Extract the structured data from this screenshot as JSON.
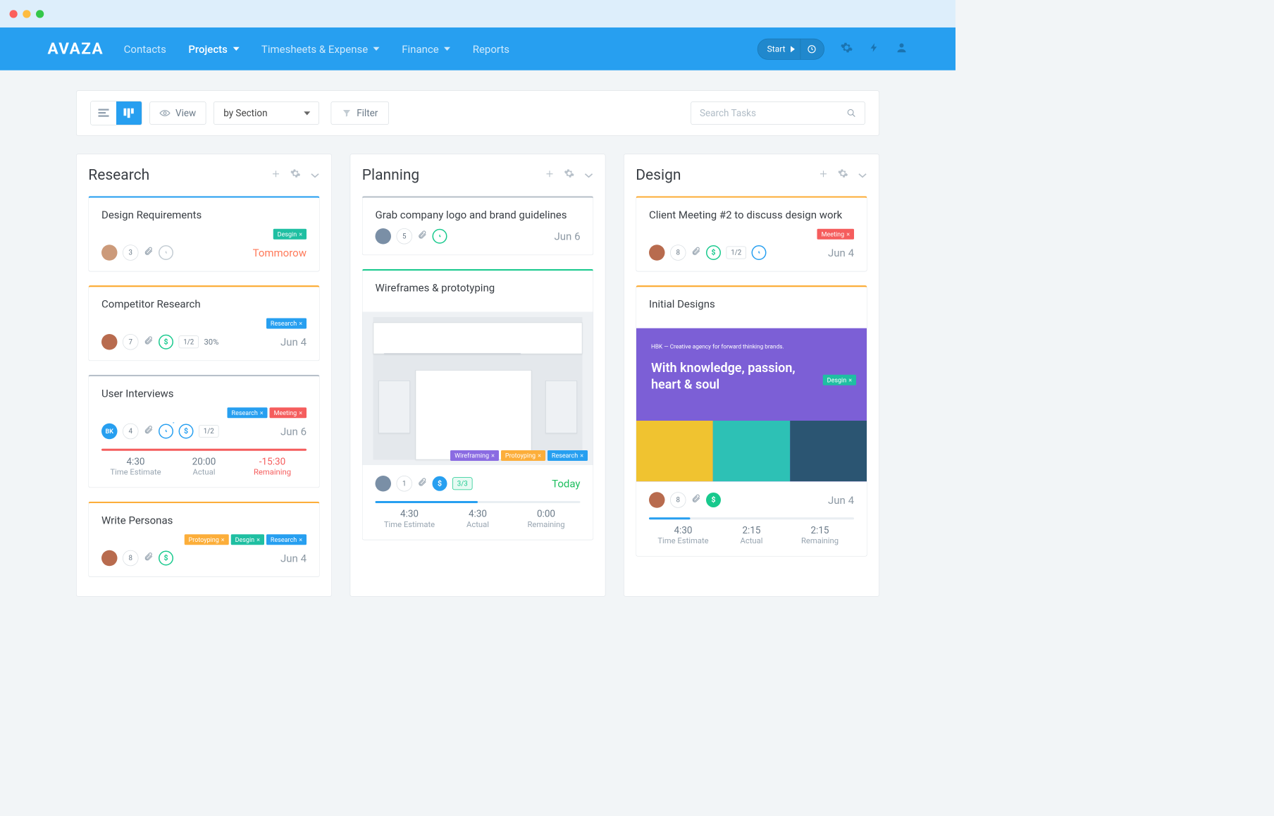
{
  "nav": {
    "logo": "AVAZA",
    "items": [
      "Contacts",
      "Projects",
      "Timesheets & Expense",
      "Finance",
      "Reports"
    ],
    "start": "Start"
  },
  "toolbar": {
    "view": "View",
    "view_value": "by Section",
    "filter": "Filter",
    "search_placeholder": "Search Tasks"
  },
  "columns": [
    {
      "title": "Research",
      "cards": [
        {
          "accent": "blue",
          "title": "Design Requirements",
          "tags": [
            {
              "label": "Desgin",
              "color": "t-teal"
            }
          ],
          "avatar": "a1",
          "comments": "3",
          "extra": [
            "clip",
            "clock-o"
          ],
          "due": "Tommorow",
          "due_class": "tomorrow"
        },
        {
          "accent": "orange",
          "title": "Competitor Research",
          "tags": [
            {
              "label": "Research",
              "color": "t-blue"
            }
          ],
          "avatar": "a2",
          "comments": "7",
          "extra": [
            "clip",
            "dollar-g",
            "ratio-12",
            "pct-30"
          ],
          "due": "Jun 4"
        },
        {
          "accent": "gray",
          "title": "User Interviews",
          "tags": [
            {
              "label": "Research",
              "color": "t-blue"
            },
            {
              "label": "Meeting",
              "color": "t-red"
            }
          ],
          "avatar": "bk",
          "avatar_text": "BK",
          "comments": "4",
          "extra": [
            "clip",
            "clock-b-tick",
            "dollar-b",
            "ratio-12"
          ],
          "due": "Jun 6",
          "progress": {
            "color": "red",
            "pct": 100
          },
          "times": {
            "estimate": "4:30",
            "actual": "20:00",
            "remaining": "-15:30",
            "neg": true
          }
        },
        {
          "accent": "orange",
          "title": "Write Personas",
          "tags": [
            {
              "label": "Protoyping",
              "color": "t-orange"
            },
            {
              "label": "Desgin",
              "color": "t-teal"
            },
            {
              "label": "Research",
              "color": "t-blue"
            }
          ],
          "avatar": "a2",
          "comments": "8",
          "extra": [
            "clip",
            "dollar-g"
          ],
          "due": "Jun 4"
        }
      ]
    },
    {
      "title": "Planning",
      "cards": [
        {
          "accent": "gray",
          "title": "Grab company logo and brand guidelines",
          "avatar": "a3",
          "comments": "5",
          "extra": [
            "clip",
            "clock-g"
          ],
          "due": "Jun 6"
        },
        {
          "accent": "green",
          "title": "Wireframes & prototyping",
          "thumb": "wire",
          "thumb_tags": [
            {
              "label": "Wireframing",
              "color": "t-purple"
            },
            {
              "label": "Protoyping",
              "color": "t-orange"
            },
            {
              "label": "Research",
              "color": "t-blue"
            }
          ],
          "avatar": "a3",
          "comments": "1",
          "extra": [
            "clip",
            "dollar-fb",
            "ratio-33g"
          ],
          "due": "Today",
          "due_class": "today",
          "progress": {
            "color": "blue",
            "pct": 50
          },
          "times": {
            "estimate": "4:30",
            "actual": "4:30",
            "remaining": "0:00"
          }
        }
      ]
    },
    {
      "title": "Design",
      "cards": [
        {
          "accent": "orange",
          "title": "Client Meeting #2 to discuss design work",
          "tags": [
            {
              "label": "Meeting",
              "color": "t-red"
            }
          ],
          "avatar": "a2",
          "comments": "8",
          "extra": [
            "clip",
            "dollar-g",
            "ratio-12",
            "clock-b"
          ],
          "due": "Jun 4"
        },
        {
          "accent": "orange",
          "title": "Initial Designs",
          "thumb": "purple",
          "thumb_hero": "With knowledge, passion, heart & soul",
          "thumb_hero_label": "HBK — Creative agency for forward thinking brands.",
          "thumb_tags_right": {
            "label": "Desgin",
            "color": "t-teal"
          },
          "avatar": "a2",
          "comments": "8",
          "extra": [
            "clip",
            "dollar-fg"
          ],
          "due": "Jun 4",
          "progress": {
            "color": "blue",
            "pct": 20
          },
          "times": {
            "estimate": "4:30",
            "actual": "2:15",
            "remaining": "2:15"
          }
        }
      ]
    }
  ],
  "labels": {
    "estimate": "Time Estimate",
    "actual": "Actual",
    "remaining": "Remaining"
  }
}
